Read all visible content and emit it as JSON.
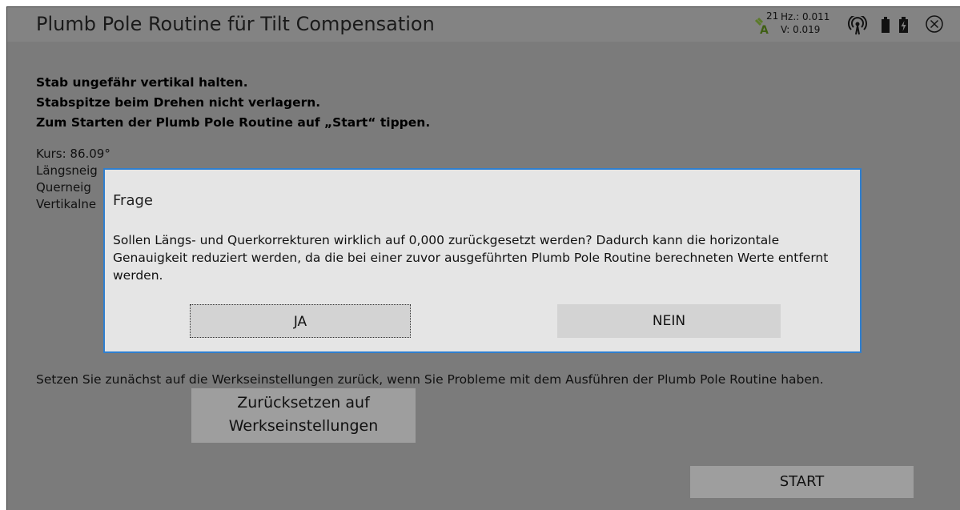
{
  "window": {
    "title": "Plumb Pole Routine für Tilt Compensation"
  },
  "status_bar": {
    "satellite_count": "21",
    "satellite_letter": "A",
    "hz": "Hz.: 0.011",
    "v": "V: 0.019",
    "icons": [
      "satellite-icon",
      "radio-icon",
      "battery-icon",
      "battery-charging-icon",
      "close-icon"
    ]
  },
  "instructions": [
    "Stab ungefähr vertikal halten.",
    "Stabspitze beim Drehen nicht verlagern.",
    "Zum Starten der Plumb Pole Routine auf „Start“ tippen."
  ],
  "info": {
    "kurs": "Kurs: 86.09°",
    "laengsneigung": "Längsneig",
    "querneigung": "Querneig",
    "vertikalneigung": "Vertikalne"
  },
  "reset": {
    "note": "Setzen Sie zunächst auf die Werkseinstellungen zurück, wenn Sie Probleme mit dem Ausführen der Plumb Pole Routine haben.",
    "button_line1": "Zurücksetzen auf",
    "button_line2": "Werkseinstellungen"
  },
  "start_button": "START",
  "dialog": {
    "title": "Frage",
    "message": "Sollen Längs- und Querkorrekturen wirklich auf 0,000 zurückgesetzt werden? Dadurch kann die horizontale Genauigkeit reduziert werden, da die bei einer zuvor ausgeführten Plumb Pole Routine berechneten Werte entfernt werden.",
    "yes_label": "JA",
    "no_label": "NEIN"
  },
  "colors": {
    "background": "#7b7b7b",
    "dialog_border": "#2f7fcf",
    "dialog_bg": "#e5e5e5",
    "button_bg": "#9e9e9e"
  }
}
